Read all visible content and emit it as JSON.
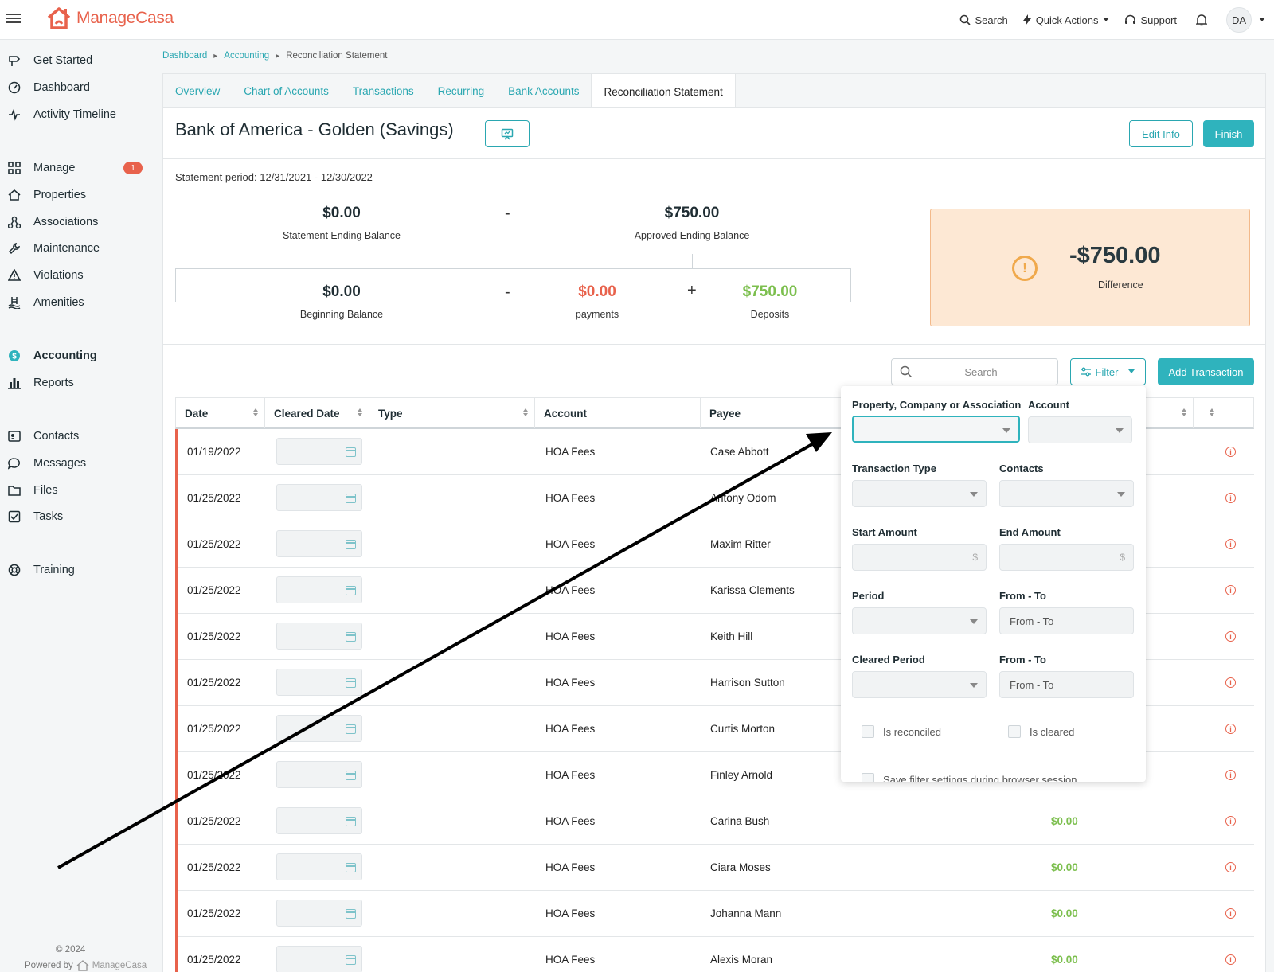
{
  "app": {
    "logo_text_prefix": "Manage",
    "logo_text_suffix": "Casa",
    "top_actions": {
      "search": "Search",
      "quick_actions": "Quick Actions",
      "support": "Support",
      "avatar": "DA"
    },
    "accent_color": "#2fb3bd",
    "brand_color": "#e8624c"
  },
  "sidebar": {
    "items": [
      {
        "label": "Get Started",
        "icon": "signpost-icon"
      },
      {
        "label": "Dashboard",
        "icon": "gauge-icon"
      },
      {
        "label": "Activity Timeline",
        "icon": "pulse-icon"
      },
      {
        "label": "Manage",
        "icon": "grid-icon",
        "badge": "1"
      },
      {
        "label": "Properties",
        "icon": "house-icon"
      },
      {
        "label": "Associations",
        "icon": "network-icon"
      },
      {
        "label": "Maintenance",
        "icon": "wrench-icon"
      },
      {
        "label": "Violations",
        "icon": "warning-triangle-icon"
      },
      {
        "label": "Amenities",
        "icon": "pool-icon"
      },
      {
        "label": "Accounting",
        "icon": "dollar-circle-icon",
        "active": true
      },
      {
        "label": "Reports",
        "icon": "bar-chart-icon"
      },
      {
        "label": "Contacts",
        "icon": "contact-card-icon"
      },
      {
        "label": "Messages",
        "icon": "chat-bubble-icon"
      },
      {
        "label": "Files",
        "icon": "folder-icon"
      },
      {
        "label": "Tasks",
        "icon": "checkbox-icon"
      },
      {
        "label": "Training",
        "icon": "lifebuoy-icon"
      }
    ],
    "powered_by": "Powered by",
    "powered_brand": "ManageCasa",
    "copyright": "© 2024"
  },
  "breadcrumb": {
    "items": [
      "Dashboard",
      "Accounting",
      "Reconciliation Statement"
    ]
  },
  "tabs": [
    {
      "label": "Overview"
    },
    {
      "label": "Chart of Accounts"
    },
    {
      "label": "Transactions"
    },
    {
      "label": "Recurring"
    },
    {
      "label": "Bank Accounts"
    },
    {
      "label": "Reconciliation Statement",
      "active": true
    }
  ],
  "header": {
    "title": "Bank of America - Golden (Savings)",
    "edit_label": "Edit Info",
    "finish_label": "Finish"
  },
  "statement": {
    "period_label": "Statement period: 12/31/2021 - 12/30/2022",
    "ending_balance": {
      "value": "$0.00",
      "label": "Statement Ending Balance"
    },
    "approved_balance": {
      "value": "$750.00",
      "label": "Approved Ending Balance"
    },
    "beginning_balance": {
      "value": "$0.00",
      "label": "Beginning Balance"
    },
    "payments": {
      "value": "$0.00",
      "label": "payments"
    },
    "deposits": {
      "value": "$750.00",
      "label": "Deposits"
    },
    "minus": "-",
    "plus": "+",
    "difference": {
      "value": "-$750.00",
      "label": "Difference"
    }
  },
  "toolbar": {
    "search_placeholder": "Search",
    "filter_label": "Filter",
    "add_label": "Add Transaction"
  },
  "table": {
    "columns": [
      "Date",
      "Cleared Date",
      "Type",
      "Account",
      "Payee"
    ],
    "rows": [
      {
        "date": "01/19/2022",
        "account": "HOA Fees",
        "payee": "Case Abbott",
        "amount": ""
      },
      {
        "date": "01/25/2022",
        "account": "HOA Fees",
        "payee": "Antony Odom",
        "amount": ""
      },
      {
        "date": "01/25/2022",
        "account": "HOA Fees",
        "payee": "Maxim Ritter",
        "amount": ""
      },
      {
        "date": "01/25/2022",
        "account": "HOA Fees",
        "payee": "Karissa Clements",
        "amount": ""
      },
      {
        "date": "01/25/2022",
        "account": "HOA Fees",
        "payee": "Keith Hill",
        "amount": ""
      },
      {
        "date": "01/25/2022",
        "account": "HOA Fees",
        "payee": "Harrison Sutton",
        "amount": ""
      },
      {
        "date": "01/25/2022",
        "account": "HOA Fees",
        "payee": "Curtis Morton",
        "amount": ""
      },
      {
        "date": "01/25/2022",
        "account": "HOA Fees",
        "payee": "Finley Arnold",
        "amount": ""
      },
      {
        "date": "01/25/2022",
        "account": "HOA Fees",
        "payee": "Carina Bush",
        "amount": "$0.00"
      },
      {
        "date": "01/25/2022",
        "account": "HOA Fees",
        "payee": "Ciara Moses",
        "amount": "$0.00"
      },
      {
        "date": "01/25/2022",
        "account": "HOA Fees",
        "payee": "Johanna Mann",
        "amount": "$0.00"
      },
      {
        "date": "01/25/2022",
        "account": "HOA Fees",
        "payee": "Alexis Moran",
        "amount": "$0.00"
      }
    ]
  },
  "filter_panel": {
    "property_label": "Property, Company or Association",
    "account_label": "Account",
    "transaction_type_label": "Transaction Type",
    "contacts_label": "Contacts",
    "start_amount_label": "Start Amount",
    "end_amount_label": "End Amount",
    "currency_symbol": "$",
    "period_label": "Period",
    "from_to_label": "From - To",
    "from_to_placeholder": "From - To",
    "cleared_period_label": "Cleared Period",
    "is_reconciled": "Is reconciled",
    "is_cleared": "Is cleared",
    "save_settings": "Save filter settings during browser session"
  }
}
